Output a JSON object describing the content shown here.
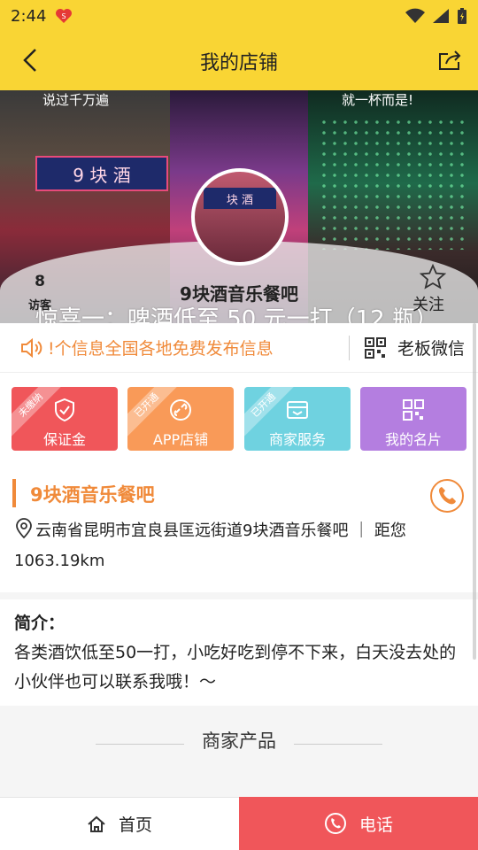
{
  "status_bar": {
    "time": "2:44"
  },
  "nav": {
    "title": "我的店铺"
  },
  "hero": {
    "caption_left": "说过千万遍",
    "caption_right": "就一杯而是!",
    "sign_text": "9 块 酒",
    "avatar_sign": "块 酒",
    "marquee": "惊喜一：啤酒低至 50 元一打（12 瓶）",
    "shop_name": "9块酒音乐餐吧",
    "visits": {
      "count": "8",
      "label": "访客"
    },
    "follow_label": "关注"
  },
  "notice": {
    "text": "!个信息全国各地免费发布信息",
    "boss_wechat": "老板微信"
  },
  "features": [
    {
      "label": "保证金",
      "ribbon": "未缴纳",
      "icon": "shield-check-icon"
    },
    {
      "label": "APP店铺",
      "ribbon": "已开通",
      "icon": "link-icon"
    },
    {
      "label": "商家服务",
      "ribbon": "已开通",
      "icon": "service-icon"
    },
    {
      "label": "我的名片",
      "ribbon": "",
      "icon": "qr-code-icon"
    }
  ],
  "info": {
    "name": "9块酒音乐餐吧",
    "address": "云南省昆明市宜良县匡远街道9块酒音乐餐吧 ｜ 距您1063.19km"
  },
  "intro": {
    "title": "简介：",
    "text": "各类酒饮低至50一打，小吃好吃到停不下来，白天没去处的小伙伴也可以联系我哦！～"
  },
  "section": {
    "title": "商家产品"
  },
  "bottom": {
    "home_label": "首页",
    "call_label": "电话"
  },
  "colors": {
    "brand_yellow": "#f9d534",
    "accent_orange": "#f08a3a",
    "call_red": "#f0565a"
  }
}
